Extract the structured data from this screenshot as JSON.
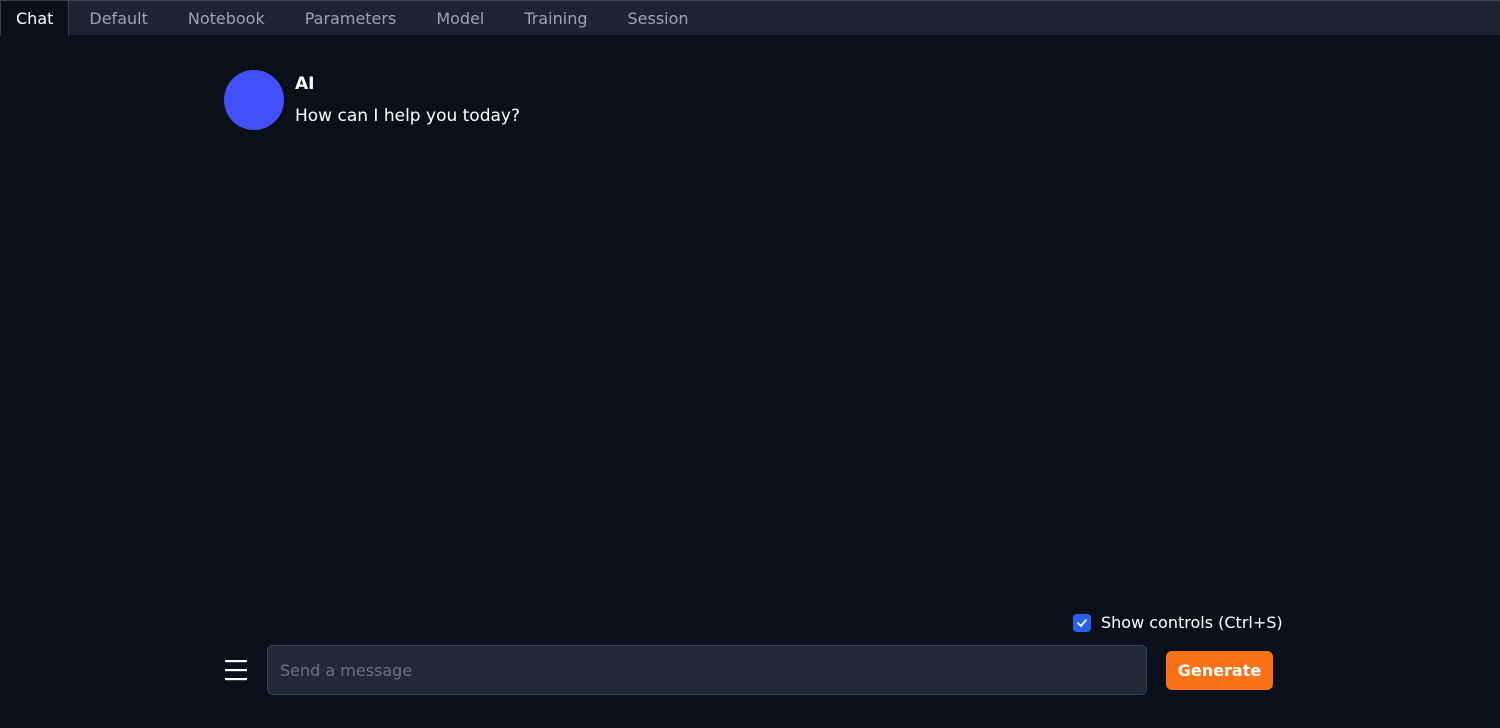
{
  "tabs": [
    {
      "label": "Chat",
      "active": true
    },
    {
      "label": "Default",
      "active": false
    },
    {
      "label": "Notebook",
      "active": false
    },
    {
      "label": "Parameters",
      "active": false
    },
    {
      "label": "Model",
      "active": false
    },
    {
      "label": "Training",
      "active": false
    },
    {
      "label": "Session",
      "active": false
    }
  ],
  "chat": {
    "messages": [
      {
        "sender": "AI",
        "text": "How can I help you today?",
        "avatar_color": "#4450f7"
      }
    ]
  },
  "controls": {
    "show_controls_label": "Show controls (Ctrl+S)",
    "show_controls_checked": true
  },
  "input": {
    "placeholder": "Send a message",
    "value": ""
  },
  "buttons": {
    "generate_label": "Generate"
  },
  "icons": {
    "menu": "hamburger-menu-icon",
    "checkbox": "checkmark-icon"
  },
  "colors": {
    "background": "#0b0f19",
    "tabbar": "#1f2230",
    "accent": "#f97316",
    "checkbox": "#2563eb",
    "avatar": "#4450f7"
  }
}
